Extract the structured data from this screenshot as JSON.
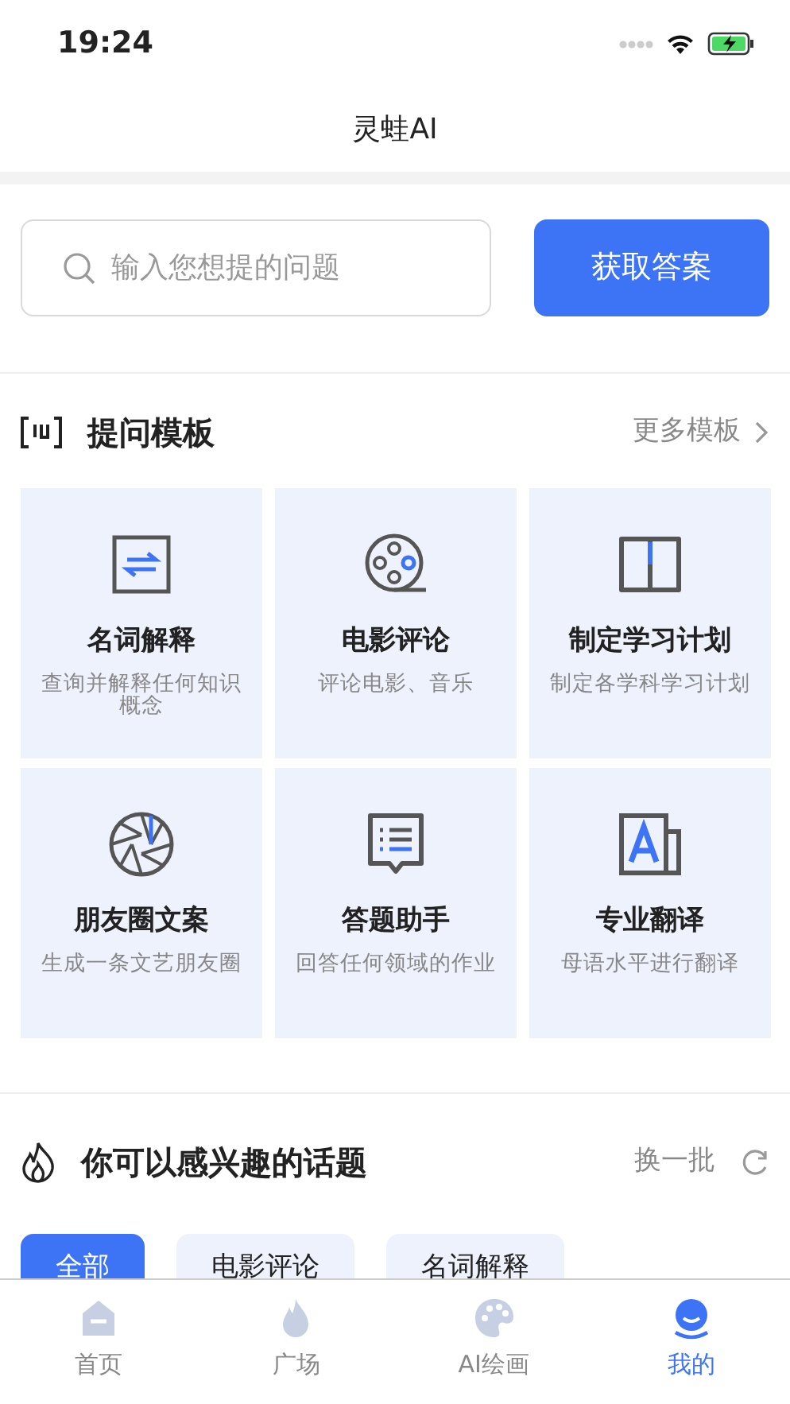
{
  "status_bar": {
    "time": "19:24"
  },
  "header": {
    "title": "灵蛙AI"
  },
  "search": {
    "placeholder": "输入您想提的问题",
    "button": "获取答案"
  },
  "templates": {
    "title": "提问模板",
    "more": "更多模板",
    "items": [
      {
        "kind": "glossary",
        "title": "名词解释",
        "desc": "查询并解释任何知识概念"
      },
      {
        "kind": "film",
        "title": "电影评论",
        "desc": "评论电影、音乐"
      },
      {
        "kind": "book",
        "title": "制定学习计划",
        "desc": "制定各学科学习计划"
      },
      {
        "kind": "aperture",
        "title": "朋友圈文案",
        "desc": "生成一条文艺朋友圈"
      },
      {
        "kind": "list",
        "title": "答题助手",
        "desc": "回答任何领域的作业"
      },
      {
        "kind": "translate",
        "title": "专业翻译",
        "desc": "母语水平进行翻译"
      }
    ]
  },
  "topics": {
    "title": "你可以感兴趣的话题",
    "refresh": "换一批",
    "chips": [
      {
        "label": "全部",
        "selected": true
      },
      {
        "label": "电影评论",
        "selected": false
      },
      {
        "label": "名词解释",
        "selected": false
      }
    ]
  },
  "tab_bar": [
    {
      "kind": "home",
      "label": "首页",
      "selected": false
    },
    {
      "kind": "fire",
      "label": "广场",
      "selected": false
    },
    {
      "kind": "palette",
      "label": "AI绘画",
      "selected": false
    },
    {
      "kind": "face",
      "label": "我的",
      "selected": true
    }
  ]
}
